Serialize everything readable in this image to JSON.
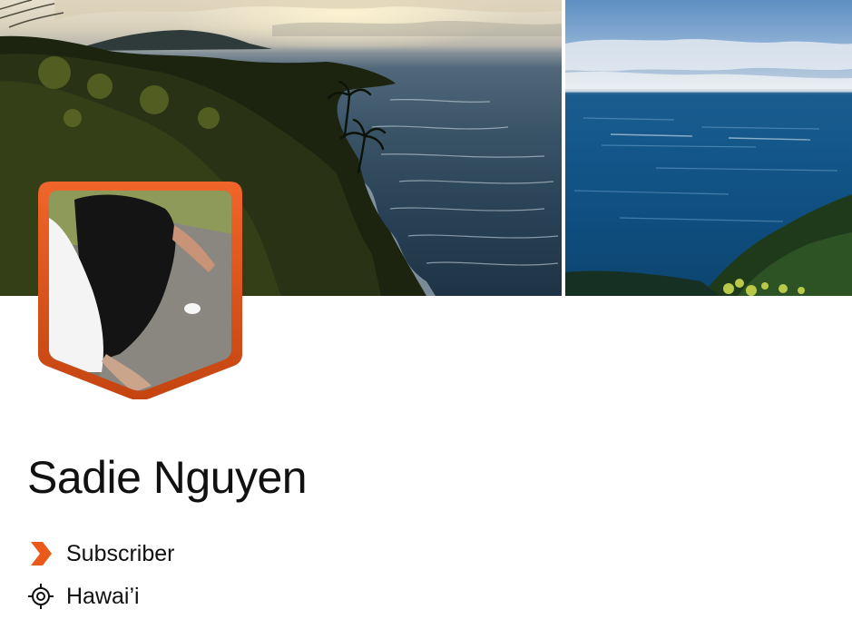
{
  "profile": {
    "name": "Sadie Nguyen",
    "badge": {
      "label": "Subscriber",
      "icon": "chevron-badge-icon"
    },
    "location": {
      "label": "Hawai’i",
      "icon": "location-target-icon"
    }
  },
  "cover": {
    "images": [
      {
        "icon": "coastline-sunset-photo"
      },
      {
        "icon": "ocean-horizon-photo"
      }
    ]
  },
  "avatar": {
    "icon": "profile-photo",
    "frame_color": "#e65f1b"
  },
  "colors": {
    "accent": "#e8591a",
    "text": "#111111",
    "background": "#ffffff"
  }
}
